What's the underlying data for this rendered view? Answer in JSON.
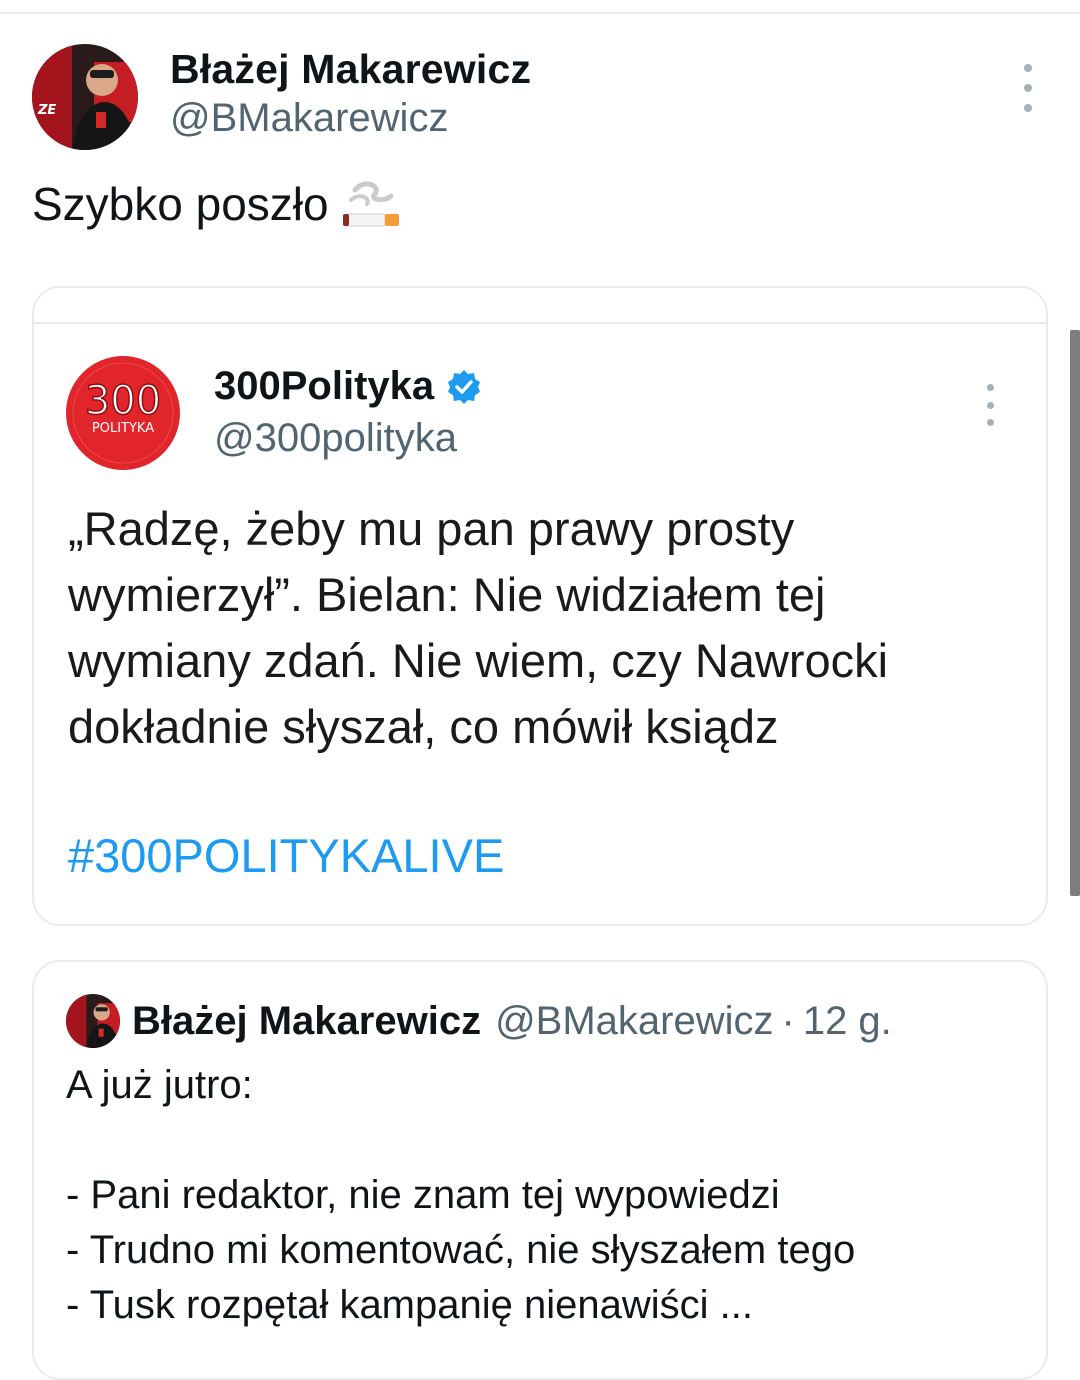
{
  "tweet": {
    "author_name": "Błażej Makarewicz",
    "author_handle": "@BMakarewicz",
    "text": "Szybko poszło",
    "emoji": "cigarette-emoji"
  },
  "quoted": {
    "author_name": "300Polityka",
    "author_handle": "@300polityka",
    "logo_number": "300",
    "logo_word": "POLITYKA",
    "text": "„Radzę, żeby mu pan prawy prosty wymierzył”. Bielan: Nie widziałem tej wymiany zdań. Nie wiem, czy Nawrocki dokładnie słyszał, co mówił ksiądz",
    "hashtag": "#300POLITYKALIVE"
  },
  "reply": {
    "author_name": "Błażej Makarewicz",
    "author_handle": "@BMakarewicz",
    "separator": "·",
    "time": "12 g.",
    "lines": [
      "A już jutro:",
      "",
      "- Pani redaktor, nie znam tej wypowiedzi",
      "- Trudno mi komentować, nie słyszałem tego",
      "- Tusk rozpętał kampanię nienawiści ..."
    ]
  },
  "colors": {
    "link": "#1d9bf0",
    "muted": "#536471",
    "border": "#e6ecf0",
    "logo_red": "#e1252b"
  }
}
